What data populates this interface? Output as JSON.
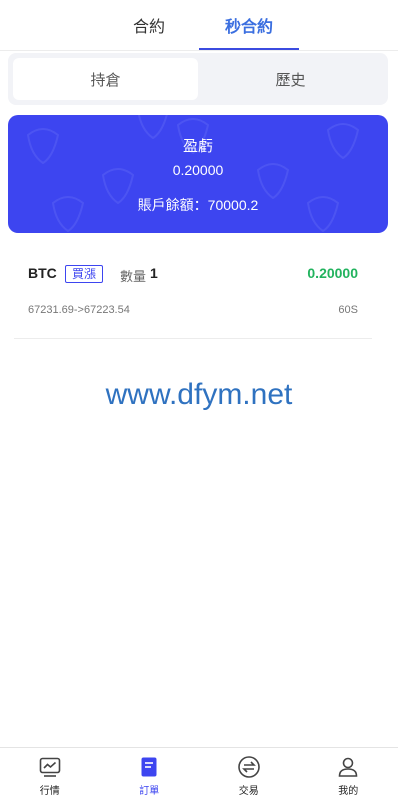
{
  "top_tabs": [
    {
      "label": "合約",
      "active": false
    },
    {
      "label": "秒合約",
      "active": true
    }
  ],
  "segment": [
    {
      "label": "持倉",
      "active": true
    },
    {
      "label": "歷史",
      "active": false
    }
  ],
  "summary": {
    "title": "盈虧",
    "pnl": "0.20000",
    "balance": "賬戶餘額：70000.2",
    "background_color": "#3d45f0"
  },
  "orders": [
    {
      "symbol": "BTC",
      "side": "買漲",
      "qty_label": "數量",
      "qty": "1",
      "pnl": "0.20000",
      "prices": "67231.69->67223.54",
      "duration": "60S"
    }
  ],
  "watermark": "www.dfym.net",
  "bottom_nav": [
    {
      "label": "行情",
      "icon": "chart-monitor-icon",
      "active": false
    },
    {
      "label": "訂單",
      "icon": "order-doc-icon",
      "active": true
    },
    {
      "label": "交易",
      "icon": "exchange-icon",
      "active": false
    },
    {
      "label": "我的",
      "icon": "user-icon",
      "active": false
    }
  ],
  "colors": {
    "accent": "#3d45f0",
    "profit": "#22b35e",
    "tab_active": "#3b6fe0"
  }
}
